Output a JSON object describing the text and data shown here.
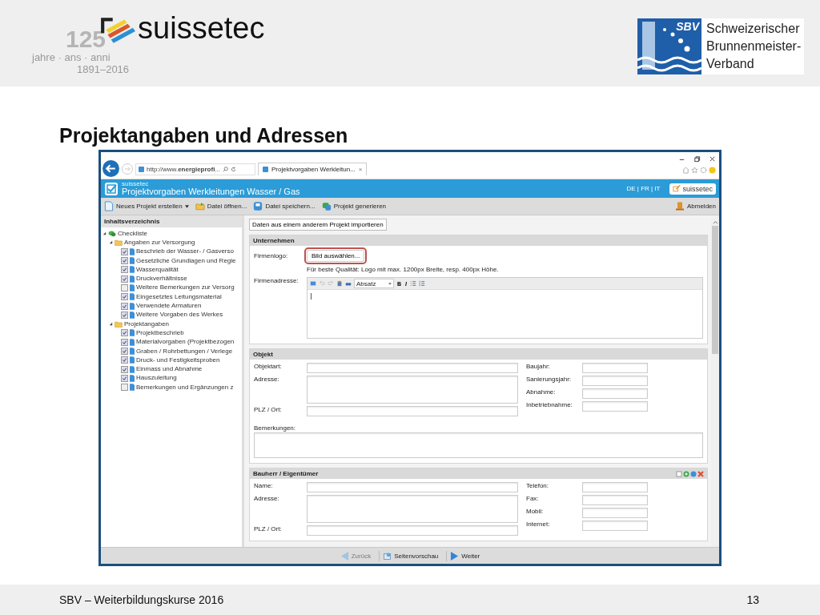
{
  "slide_header": {
    "logo_left": {
      "number": "125",
      "wordmark": "suissetec",
      "caption_1": "jahre · ans · anni",
      "caption_2": "1891–2016"
    },
    "logo_right": {
      "badge": "SBV",
      "lines": [
        "Schweizerischer",
        "Brunnenmeister-",
        "Verband"
      ]
    }
  },
  "title": "Projektangaben und Adressen",
  "browser": {
    "address": "http://www.**energieprofi**...",
    "tab": "Projektvorgaben Werkleitun...",
    "tab_close": "×"
  },
  "app": {
    "brand": "suissetec",
    "title": "Projektvorgaben Werkleitungen Wasser / Gas",
    "languages": "DE | FR | IT",
    "logo_button": "suissetec"
  },
  "toolbar": [
    {
      "label": "Neues Projekt erstellen",
      "kind": "new",
      "dropdown": true
    },
    {
      "label": "Datei öffnen...",
      "kind": "open",
      "dropdown": false
    },
    {
      "label": "Datei speichern...",
      "kind": "save",
      "dropdown": false
    },
    {
      "label": "Projekt generieren",
      "kind": "generate",
      "dropdown": false
    }
  ],
  "logout": "Abmelden",
  "sidebar": {
    "title": "Inhaltsverzeichnis",
    "tree": [
      {
        "label": "Checkliste",
        "kind": "checklist",
        "expanded": true,
        "children": [
          {
            "label": "Angaben zur Versorgung",
            "kind": "folder",
            "expanded": true,
            "children": [
              {
                "label": "Beschrieb der Wasser- / Gasverso",
                "kind": "page",
                "checked": true
              },
              {
                "label": "Gesetzliche Grundlagen und Regle",
                "kind": "page",
                "checked": true
              },
              {
                "label": "Wasserqualität",
                "kind": "page",
                "checked": true
              },
              {
                "label": "Druckverhältnisse",
                "kind": "page",
                "checked": true
              },
              {
                "label": "Weitere Bemerkungen zur Versorg",
                "kind": "page",
                "checked": false
              },
              {
                "label": "Eingesetztes Leitungsmaterial",
                "kind": "page",
                "checked": true
              },
              {
                "label": "Verwendete Armaturen",
                "kind": "page",
                "checked": true
              },
              {
                "label": "Weitere Vorgaben des Werkes",
                "kind": "page",
                "checked": true
              }
            ]
          },
          {
            "label": "Projektangaben",
            "kind": "folder",
            "expanded": true,
            "children": [
              {
                "label": "Projektbeschrieb",
                "kind": "page",
                "checked": true
              },
              {
                "label": "Materialvorgaben (Projektbezogen",
                "kind": "page",
                "checked": true
              },
              {
                "label": "Graben / Rohrbettungen / Verlege",
                "kind": "page",
                "checked": true
              },
              {
                "label": "Druck- und Festigkeitsproben",
                "kind": "page",
                "checked": true
              },
              {
                "label": "Einmass und Abnahme",
                "kind": "page",
                "checked": true
              },
              {
                "label": "Hauszuleitung",
                "kind": "page",
                "checked": true
              },
              {
                "label": "Bemerkungen und Ergänzungen z",
                "kind": "page",
                "checked": false
              }
            ]
          }
        ]
      }
    ]
  },
  "import_button": "Daten aus einem anderem Projekt importieren",
  "sections": [
    {
      "title": "Unternehmen",
      "kind": "company",
      "logo_label": "Firmenlogo:",
      "logo_button": {
        "label": "Bild auswählen...",
        "highlighted": true
      },
      "hint": "Für beste Qualität: Logo mit max. 1200px Breite, resp. 400px Höhe.",
      "address_label": "Firmenadresse:",
      "editor": {
        "format": "Absatz",
        "bold": "B",
        "italic": "I"
      }
    },
    {
      "title": "Objekt",
      "kind": "form",
      "actions": false,
      "left": [
        {
          "label": "Objektart:",
          "kind": "input"
        },
        {
          "label": "Adresse:",
          "kind": "textarea"
        },
        {
          "label": "PLZ / Ort:",
          "kind": "input"
        }
      ],
      "right": [
        {
          "label": "Baujahr:"
        },
        {
          "label": "Sanierungsjahr:"
        },
        {
          "label": "Abnahme:"
        },
        {
          "label": "Inbetriebnahme:"
        }
      ],
      "remarks_label": "Bemerkungen:"
    },
    {
      "title": "Bauherr / Eigentümer",
      "kind": "form",
      "actions": true,
      "left": [
        {
          "label": "Name:",
          "kind": "input"
        },
        {
          "label": "Adresse:",
          "kind": "textarea"
        },
        {
          "label": "PLZ / Ort:",
          "kind": "input"
        }
      ],
      "right": [
        {
          "label": "Telefon:"
        },
        {
          "label": "Fax:"
        },
        {
          "label": "Mobil:"
        },
        {
          "label": "Internet:"
        }
      ]
    }
  ],
  "nav": [
    {
      "label": "Zurück",
      "kind": "back",
      "disabled": true
    },
    {
      "label": "Seitenvorschau",
      "kind": "preview",
      "disabled": false
    },
    {
      "label": "Weiter",
      "kind": "next",
      "disabled": false
    }
  ],
  "footer": {
    "text": "SBV – Weiterbildungskurse 2016",
    "page_number": "13"
  }
}
